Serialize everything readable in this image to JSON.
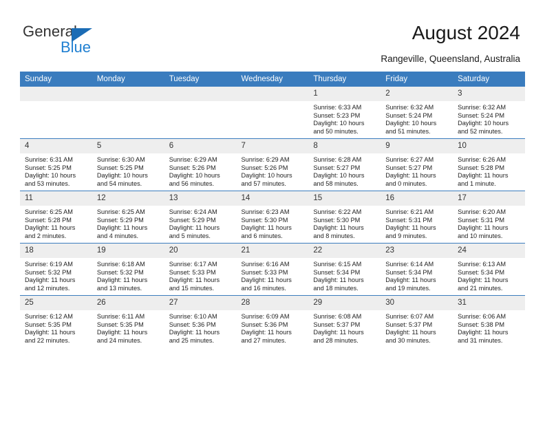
{
  "brand": {
    "name_top": "General",
    "name_bottom": "Blue",
    "accent_color": "#1f7fd1",
    "triangle_color": "#1b6cb5"
  },
  "header": {
    "title": "August 2024",
    "subtitle": "Rangeville, Queensland, Australia"
  },
  "calendar": {
    "header_bg": "#3a7cbe",
    "daynum_bg": "#eeeeee",
    "weekdays": [
      "Sunday",
      "Monday",
      "Tuesday",
      "Wednesday",
      "Thursday",
      "Friday",
      "Saturday"
    ],
    "weeks": [
      [
        {
          "day": "",
          "empty": true
        },
        {
          "day": "",
          "empty": true
        },
        {
          "day": "",
          "empty": true
        },
        {
          "day": "",
          "empty": true
        },
        {
          "day": "1",
          "sunrise": "Sunrise: 6:33 AM",
          "sunset": "Sunset: 5:23 PM",
          "daylight1": "Daylight: 10 hours",
          "daylight2": "and 50 minutes."
        },
        {
          "day": "2",
          "sunrise": "Sunrise: 6:32 AM",
          "sunset": "Sunset: 5:24 PM",
          "daylight1": "Daylight: 10 hours",
          "daylight2": "and 51 minutes."
        },
        {
          "day": "3",
          "sunrise": "Sunrise: 6:32 AM",
          "sunset": "Sunset: 5:24 PM",
          "daylight1": "Daylight: 10 hours",
          "daylight2": "and 52 minutes."
        }
      ],
      [
        {
          "day": "4",
          "sunrise": "Sunrise: 6:31 AM",
          "sunset": "Sunset: 5:25 PM",
          "daylight1": "Daylight: 10 hours",
          "daylight2": "and 53 minutes."
        },
        {
          "day": "5",
          "sunrise": "Sunrise: 6:30 AM",
          "sunset": "Sunset: 5:25 PM",
          "daylight1": "Daylight: 10 hours",
          "daylight2": "and 54 minutes."
        },
        {
          "day": "6",
          "sunrise": "Sunrise: 6:29 AM",
          "sunset": "Sunset: 5:26 PM",
          "daylight1": "Daylight: 10 hours",
          "daylight2": "and 56 minutes."
        },
        {
          "day": "7",
          "sunrise": "Sunrise: 6:29 AM",
          "sunset": "Sunset: 5:26 PM",
          "daylight1": "Daylight: 10 hours",
          "daylight2": "and 57 minutes."
        },
        {
          "day": "8",
          "sunrise": "Sunrise: 6:28 AM",
          "sunset": "Sunset: 5:27 PM",
          "daylight1": "Daylight: 10 hours",
          "daylight2": "and 58 minutes."
        },
        {
          "day": "9",
          "sunrise": "Sunrise: 6:27 AM",
          "sunset": "Sunset: 5:27 PM",
          "daylight1": "Daylight: 11 hours",
          "daylight2": "and 0 minutes."
        },
        {
          "day": "10",
          "sunrise": "Sunrise: 6:26 AM",
          "sunset": "Sunset: 5:28 PM",
          "daylight1": "Daylight: 11 hours",
          "daylight2": "and 1 minute."
        }
      ],
      [
        {
          "day": "11",
          "sunrise": "Sunrise: 6:25 AM",
          "sunset": "Sunset: 5:28 PM",
          "daylight1": "Daylight: 11 hours",
          "daylight2": "and 2 minutes."
        },
        {
          "day": "12",
          "sunrise": "Sunrise: 6:25 AM",
          "sunset": "Sunset: 5:29 PM",
          "daylight1": "Daylight: 11 hours",
          "daylight2": "and 4 minutes."
        },
        {
          "day": "13",
          "sunrise": "Sunrise: 6:24 AM",
          "sunset": "Sunset: 5:29 PM",
          "daylight1": "Daylight: 11 hours",
          "daylight2": "and 5 minutes."
        },
        {
          "day": "14",
          "sunrise": "Sunrise: 6:23 AM",
          "sunset": "Sunset: 5:30 PM",
          "daylight1": "Daylight: 11 hours",
          "daylight2": "and 6 minutes."
        },
        {
          "day": "15",
          "sunrise": "Sunrise: 6:22 AM",
          "sunset": "Sunset: 5:30 PM",
          "daylight1": "Daylight: 11 hours",
          "daylight2": "and 8 minutes."
        },
        {
          "day": "16",
          "sunrise": "Sunrise: 6:21 AM",
          "sunset": "Sunset: 5:31 PM",
          "daylight1": "Daylight: 11 hours",
          "daylight2": "and 9 minutes."
        },
        {
          "day": "17",
          "sunrise": "Sunrise: 6:20 AM",
          "sunset": "Sunset: 5:31 PM",
          "daylight1": "Daylight: 11 hours",
          "daylight2": "and 10 minutes."
        }
      ],
      [
        {
          "day": "18",
          "sunrise": "Sunrise: 6:19 AM",
          "sunset": "Sunset: 5:32 PM",
          "daylight1": "Daylight: 11 hours",
          "daylight2": "and 12 minutes."
        },
        {
          "day": "19",
          "sunrise": "Sunrise: 6:18 AM",
          "sunset": "Sunset: 5:32 PM",
          "daylight1": "Daylight: 11 hours",
          "daylight2": "and 13 minutes."
        },
        {
          "day": "20",
          "sunrise": "Sunrise: 6:17 AM",
          "sunset": "Sunset: 5:33 PM",
          "daylight1": "Daylight: 11 hours",
          "daylight2": "and 15 minutes."
        },
        {
          "day": "21",
          "sunrise": "Sunrise: 6:16 AM",
          "sunset": "Sunset: 5:33 PM",
          "daylight1": "Daylight: 11 hours",
          "daylight2": "and 16 minutes."
        },
        {
          "day": "22",
          "sunrise": "Sunrise: 6:15 AM",
          "sunset": "Sunset: 5:34 PM",
          "daylight1": "Daylight: 11 hours",
          "daylight2": "and 18 minutes."
        },
        {
          "day": "23",
          "sunrise": "Sunrise: 6:14 AM",
          "sunset": "Sunset: 5:34 PM",
          "daylight1": "Daylight: 11 hours",
          "daylight2": "and 19 minutes."
        },
        {
          "day": "24",
          "sunrise": "Sunrise: 6:13 AM",
          "sunset": "Sunset: 5:34 PM",
          "daylight1": "Daylight: 11 hours",
          "daylight2": "and 21 minutes."
        }
      ],
      [
        {
          "day": "25",
          "sunrise": "Sunrise: 6:12 AM",
          "sunset": "Sunset: 5:35 PM",
          "daylight1": "Daylight: 11 hours",
          "daylight2": "and 22 minutes."
        },
        {
          "day": "26",
          "sunrise": "Sunrise: 6:11 AM",
          "sunset": "Sunset: 5:35 PM",
          "daylight1": "Daylight: 11 hours",
          "daylight2": "and 24 minutes."
        },
        {
          "day": "27",
          "sunrise": "Sunrise: 6:10 AM",
          "sunset": "Sunset: 5:36 PM",
          "daylight1": "Daylight: 11 hours",
          "daylight2": "and 25 minutes."
        },
        {
          "day": "28",
          "sunrise": "Sunrise: 6:09 AM",
          "sunset": "Sunset: 5:36 PM",
          "daylight1": "Daylight: 11 hours",
          "daylight2": "and 27 minutes."
        },
        {
          "day": "29",
          "sunrise": "Sunrise: 6:08 AM",
          "sunset": "Sunset: 5:37 PM",
          "daylight1": "Daylight: 11 hours",
          "daylight2": "and 28 minutes."
        },
        {
          "day": "30",
          "sunrise": "Sunrise: 6:07 AM",
          "sunset": "Sunset: 5:37 PM",
          "daylight1": "Daylight: 11 hours",
          "daylight2": "and 30 minutes."
        },
        {
          "day": "31",
          "sunrise": "Sunrise: 6:06 AM",
          "sunset": "Sunset: 5:38 PM",
          "daylight1": "Daylight: 11 hours",
          "daylight2": "and 31 minutes."
        }
      ]
    ]
  }
}
